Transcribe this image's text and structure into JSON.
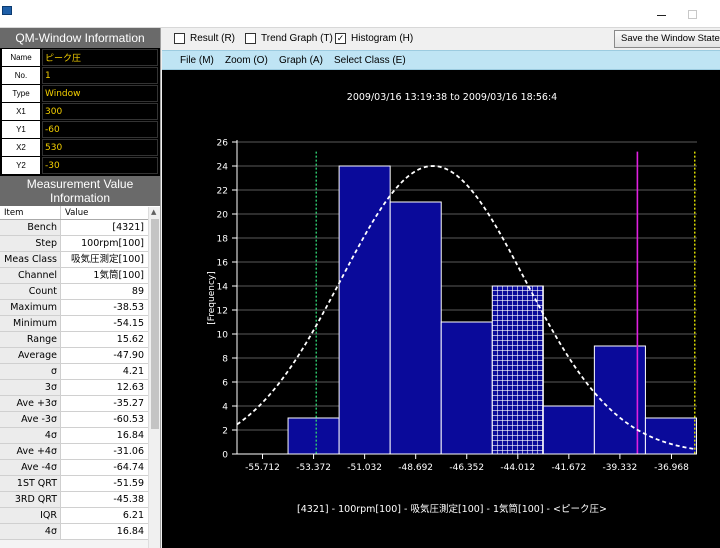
{
  "qm_window": {
    "title": "QM-Window Information",
    "rows": [
      {
        "key": "Name",
        "value": "ピーク圧"
      },
      {
        "key": "No.",
        "value": "1"
      },
      {
        "key": "Type",
        "value": "Window"
      },
      {
        "key": "X1",
        "value": "300"
      },
      {
        "key": "Y1",
        "value": "-60"
      },
      {
        "key": "X2",
        "value": "530"
      },
      {
        "key": "Y2",
        "value": "-30"
      }
    ]
  },
  "measurement": {
    "title_line1": "Measurement Value",
    "title_line2": "Information",
    "col_item": "Item",
    "col_value": "Value",
    "rows": [
      {
        "item": "Bench",
        "value": "[4321]"
      },
      {
        "item": "Step",
        "value": "100rpm[100]"
      },
      {
        "item": "Meas Class",
        "value": "吸気圧測定[100]"
      },
      {
        "item": "Channel",
        "value": "1気筒[100]"
      },
      {
        "item": "Count",
        "value": "89"
      },
      {
        "item": "Maximum",
        "value": "-38.53"
      },
      {
        "item": "Minimum",
        "value": "-54.15"
      },
      {
        "item": "Range",
        "value": "15.62"
      },
      {
        "item": "Average",
        "value": "-47.90"
      },
      {
        "item": "σ",
        "value": "4.21"
      },
      {
        "item": "3σ",
        "value": "12.63"
      },
      {
        "item": "Ave +3σ",
        "value": "-35.27"
      },
      {
        "item": "Ave -3σ",
        "value": "-60.53"
      },
      {
        "item": "4σ",
        "value": "16.84"
      },
      {
        "item": "Ave +4σ",
        "value": "-31.06"
      },
      {
        "item": "Ave -4σ",
        "value": "-64.74"
      },
      {
        "item": "1ST QRT",
        "value": "-51.59"
      },
      {
        "item": "3RD QRT",
        "value": "-45.38"
      },
      {
        "item": "IQR",
        "value": "6.21"
      },
      {
        "item": "4σ",
        "value": "16.84"
      }
    ]
  },
  "toolbar": {
    "result_label": "Result (R)",
    "trend_label": "Trend Graph (T)",
    "histogram_label": "Histogram (H)",
    "histogram_checked": true,
    "save_label": "Save the Window State (",
    "check_mark": "✓"
  },
  "menu": {
    "file": "File (M)",
    "zoom": "Zoom (O)",
    "graph": "Graph (A)",
    "select_class": "Select Class (E)"
  },
  "colors": {
    "bar_fill": "#0a0a9a",
    "bar_stroke": "#ffffff",
    "highlight_fill": "#ffffff",
    "curve": "#ffffff",
    "line_green": "#2ecc71",
    "line_magenta": "#e020e0",
    "line_yellow": "#e8e800",
    "background": "#000000",
    "value_text": "#f5d000"
  },
  "chart_data": {
    "type": "bar",
    "title": "2009/03/16 13:19:38 to 2009/03/16 18:56:4",
    "ylabel": "[Frequency]",
    "xlabel": "[4321] - 100rpm[100] - 吸気圧測定[100] - 1気筒[100] - <ピーク圧>",
    "ylim": [
      0,
      26
    ],
    "yticks": [
      0,
      2,
      4,
      6,
      8,
      10,
      12,
      14,
      16,
      18,
      20,
      22,
      24,
      26
    ],
    "xlim": [
      -56.882,
      -35.798
    ],
    "xticks": [
      -55.712,
      -53.372,
      -51.032,
      -48.692,
      -46.352,
      -44.012,
      -41.672,
      -39.332,
      -36.968
    ],
    "xtick_labels": [
      "-55.712",
      "-53.372",
      "-51.032",
      "-48.692",
      "-46.352",
      "-44.012",
      "-41.672",
      "-39.332",
      "-36.968"
    ],
    "bins": [
      {
        "x0": -54.542,
        "x1": -52.202,
        "count": 3
      },
      {
        "x0": -52.202,
        "x1": -49.862,
        "count": 24
      },
      {
        "x0": -49.862,
        "x1": -47.522,
        "count": 21
      },
      {
        "x0": -47.522,
        "x1": -45.182,
        "count": 11
      },
      {
        "x0": -45.182,
        "x1": -42.842,
        "count": 14,
        "highlighted": true
      },
      {
        "x0": -42.842,
        "x1": -40.502,
        "count": 4
      },
      {
        "x0": -40.502,
        "x1": -38.162,
        "count": 9
      },
      {
        "x0": -38.162,
        "x1": -35.822,
        "count": 3
      }
    ],
    "normal_curve": {
      "mean": -47.9,
      "sigma": 4.21,
      "peak": 24
    },
    "vertical_lines": [
      {
        "x": -53.25,
        "color": "green"
      },
      {
        "x": -38.53,
        "color": "magenta"
      },
      {
        "x": -35.9,
        "color": "yellow"
      }
    ],
    "grid": true
  }
}
